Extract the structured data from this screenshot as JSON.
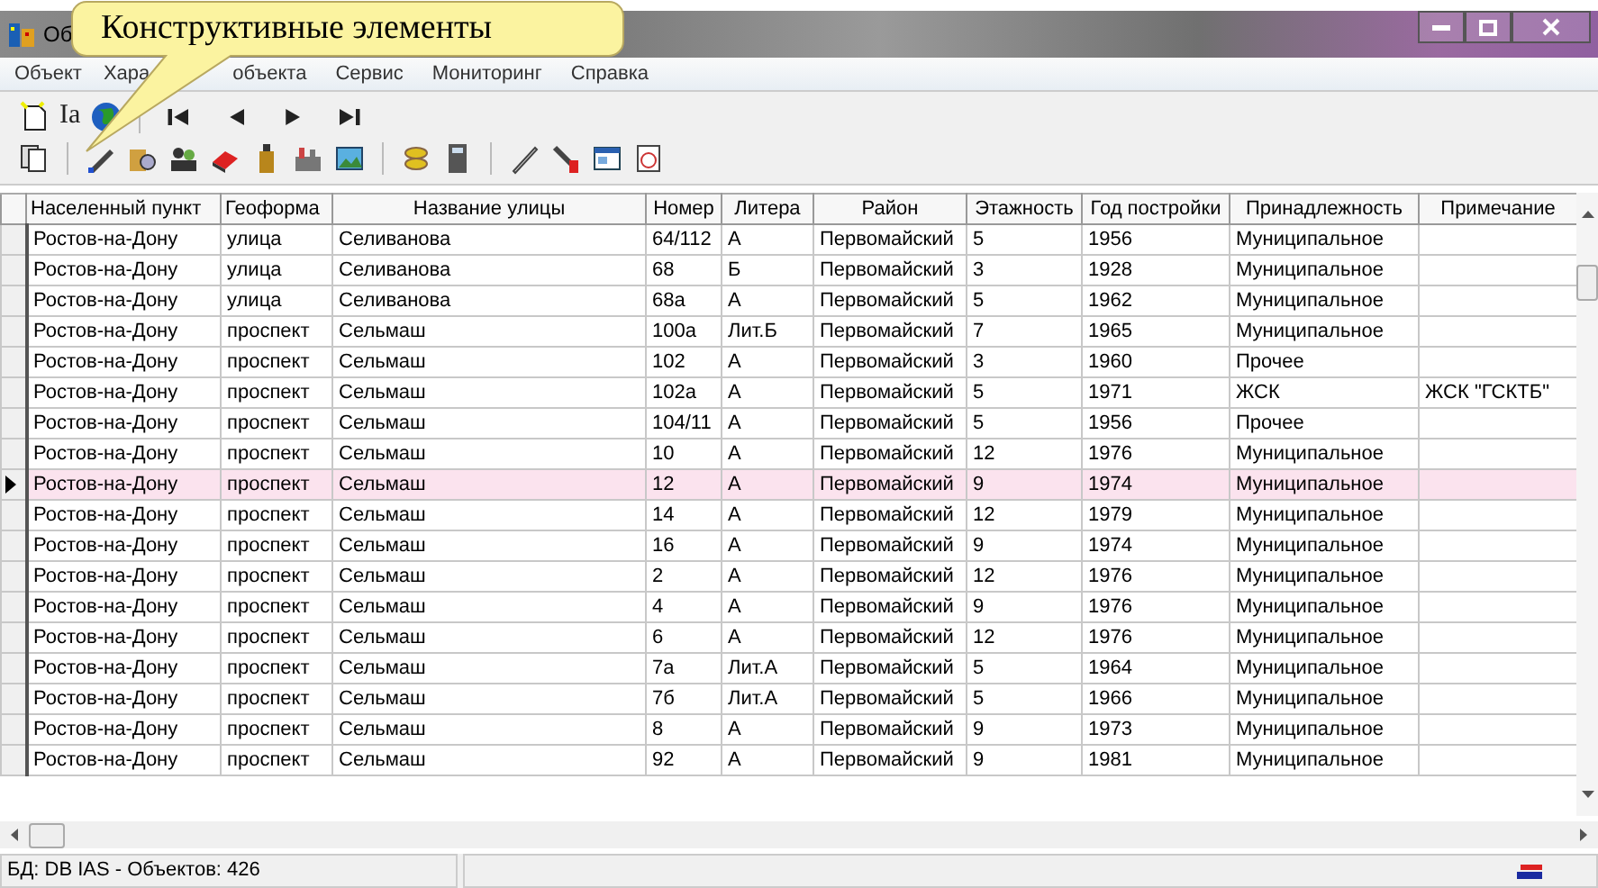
{
  "window": {
    "title": "Об"
  },
  "callout": {
    "text": "Конструктивные элементы"
  },
  "menu": [
    "Объект",
    "Хара",
    "объекта",
    "Сервис",
    "Мониторинг",
    "Справка"
  ],
  "toolbar": {
    "text_button": "Ia"
  },
  "table": {
    "columns": [
      "Населенный пункт",
      "Геоформа",
      "Название улицы",
      "Номер",
      "Литера",
      "Район",
      "Этажность",
      "Год постройки",
      "Принадлежность",
      "Примечание"
    ],
    "rows": [
      {
        "selected": false,
        "cells": [
          "Ростов-на-Дону",
          "улица",
          "Селиванова",
          "64/112",
          "А",
          "Первомайский",
          "5",
          "1956",
          "Муниципальное",
          ""
        ]
      },
      {
        "selected": false,
        "cells": [
          "Ростов-на-Дону",
          "улица",
          "Селиванова",
          "68",
          "Б",
          "Первомайский",
          "3",
          "1928",
          "Муниципальное",
          ""
        ]
      },
      {
        "selected": false,
        "cells": [
          "Ростов-на-Дону",
          "улица",
          "Селиванова",
          "68а",
          "А",
          "Первомайский",
          "5",
          "1962",
          "Муниципальное",
          ""
        ]
      },
      {
        "selected": false,
        "cells": [
          "Ростов-на-Дону",
          "проспект",
          "Сельмаш",
          "100а",
          "Лит.Б",
          "Первомайский",
          "7",
          "1965",
          "Муниципальное",
          ""
        ]
      },
      {
        "selected": false,
        "cells": [
          "Ростов-на-Дону",
          "проспект",
          "Сельмаш",
          "102",
          "А",
          "Первомайский",
          "3",
          "1960",
          "Прочее",
          ""
        ]
      },
      {
        "selected": false,
        "cells": [
          "Ростов-на-Дону",
          "проспект",
          "Сельмаш",
          "102а",
          "А",
          "Первомайский",
          "5",
          "1971",
          "ЖСК",
          "ЖСК \"ГСКТБ\""
        ]
      },
      {
        "selected": false,
        "cells": [
          "Ростов-на-Дону",
          "проспект",
          "Сельмаш",
          "104/11",
          "А",
          "Первомайский",
          "5",
          "1956",
          "Прочее",
          ""
        ]
      },
      {
        "selected": false,
        "cells": [
          "Ростов-на-Дону",
          "проспект",
          "Сельмаш",
          "10",
          "А",
          "Первомайский",
          "12",
          "1976",
          "Муниципальное",
          ""
        ]
      },
      {
        "selected": true,
        "cells": [
          "Ростов-на-Дону",
          "проспект",
          "Сельмаш",
          "12",
          "А",
          "Первомайский",
          "9",
          "1974",
          "Муниципальное",
          ""
        ]
      },
      {
        "selected": false,
        "cells": [
          "Ростов-на-Дону",
          "проспект",
          "Сельмаш",
          "14",
          "А",
          "Первомайский",
          "12",
          "1979",
          "Муниципальное",
          ""
        ]
      },
      {
        "selected": false,
        "cells": [
          "Ростов-на-Дону",
          "проспект",
          "Сельмаш",
          "16",
          "А",
          "Первомайский",
          "9",
          "1974",
          "Муниципальное",
          ""
        ]
      },
      {
        "selected": false,
        "cells": [
          "Ростов-на-Дону",
          "проспект",
          "Сельмаш",
          "2",
          "А",
          "Первомайский",
          "12",
          "1976",
          "Муниципальное",
          ""
        ]
      },
      {
        "selected": false,
        "cells": [
          "Ростов-на-Дону",
          "проспект",
          "Сельмаш",
          "4",
          "А",
          "Первомайский",
          "9",
          "1976",
          "Муниципальное",
          ""
        ]
      },
      {
        "selected": false,
        "cells": [
          "Ростов-на-Дону",
          "проспект",
          "Сельмаш",
          "6",
          "А",
          "Первомайский",
          "12",
          "1976",
          "Муниципальное",
          ""
        ]
      },
      {
        "selected": false,
        "cells": [
          "Ростов-на-Дону",
          "проспект",
          "Сельмаш",
          "7а",
          "Лит.А",
          "Первомайский",
          "5",
          "1964",
          "Муниципальное",
          ""
        ]
      },
      {
        "selected": false,
        "cells": [
          "Ростов-на-Дону",
          "проспект",
          "Сельмаш",
          "7б",
          "Лит.А",
          "Первомайский",
          "5",
          "1966",
          "Муниципальное",
          ""
        ]
      },
      {
        "selected": false,
        "cells": [
          "Ростов-на-Дону",
          "проспект",
          "Сельмаш",
          "8",
          "А",
          "Первомайский",
          "9",
          "1973",
          "Муниципальное",
          ""
        ]
      },
      {
        "selected": false,
        "cells": [
          "Ростов-на-Дону",
          "проспект",
          "Сельмаш",
          "92",
          "А",
          "Первомайский",
          "9",
          "1981",
          "Муниципальное",
          ""
        ]
      }
    ]
  },
  "status_bar": [
    "БД: DB IAS - Объектов: 426"
  ]
}
